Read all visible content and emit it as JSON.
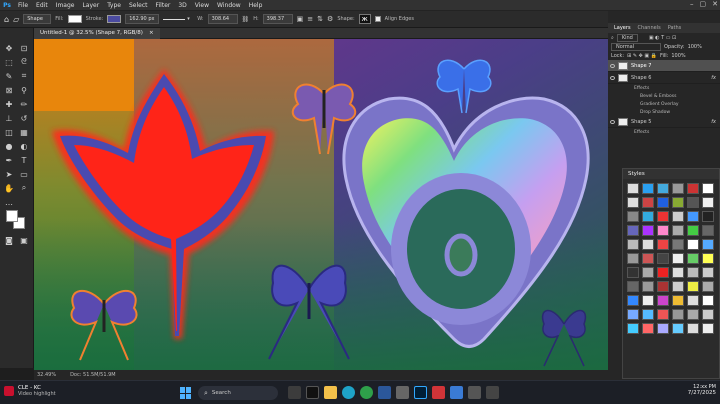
{
  "app": {
    "logo": "Ps"
  },
  "menu": [
    "File",
    "Edit",
    "Image",
    "Layer",
    "Type",
    "Select",
    "Filter",
    "3D",
    "View",
    "Window",
    "Help"
  ],
  "options": {
    "tool_mode": "Shape",
    "fill_label": "Fill:",
    "stroke_label": "Stroke:",
    "stroke_width": "162.90 px",
    "w_label": "W:",
    "w_value": "308.64",
    "h_label": "H:",
    "h_value": "398.37",
    "shape_label": "Shape:",
    "align_edges": "Align Edges",
    "fill_color": "#ffffff",
    "stroke_color": "#4b4ba0"
  },
  "document": {
    "tab_title": "Untitled-1 @ 32.5% (Shape 7, RGB/8)",
    "close": "×"
  },
  "status": {
    "zoom": "32.49%",
    "doc": "Doc: 51.5M/51.9M"
  },
  "panels": {
    "tabs": [
      "Layers",
      "Channels",
      "Paths"
    ],
    "kind": "Kind",
    "blend": "Normal",
    "opacity_label": "Opacity:",
    "opacity": "100%",
    "lock_label": "Lock:",
    "fill_label": "Fill:",
    "fill": "100%",
    "layers": [
      {
        "name": "Shape 7",
        "selected": true
      },
      {
        "name": "Shape 6",
        "selected": false,
        "fx": "fx"
      }
    ],
    "effects_label": "Effects",
    "effects": [
      "Bevel & Emboss",
      "Gradient Overlay",
      "Drop Shadow"
    ],
    "layer_bottom": {
      "name": "Shape 5",
      "fx": "fx"
    },
    "effects2_label": "Effects"
  },
  "styles": {
    "title": "Styles"
  },
  "taskbar": {
    "weather_temp": "CLE - KC",
    "weather_sub": "Video highlight",
    "search": "Search",
    "time": "12:xx PM",
    "date": "7/27/2025"
  }
}
